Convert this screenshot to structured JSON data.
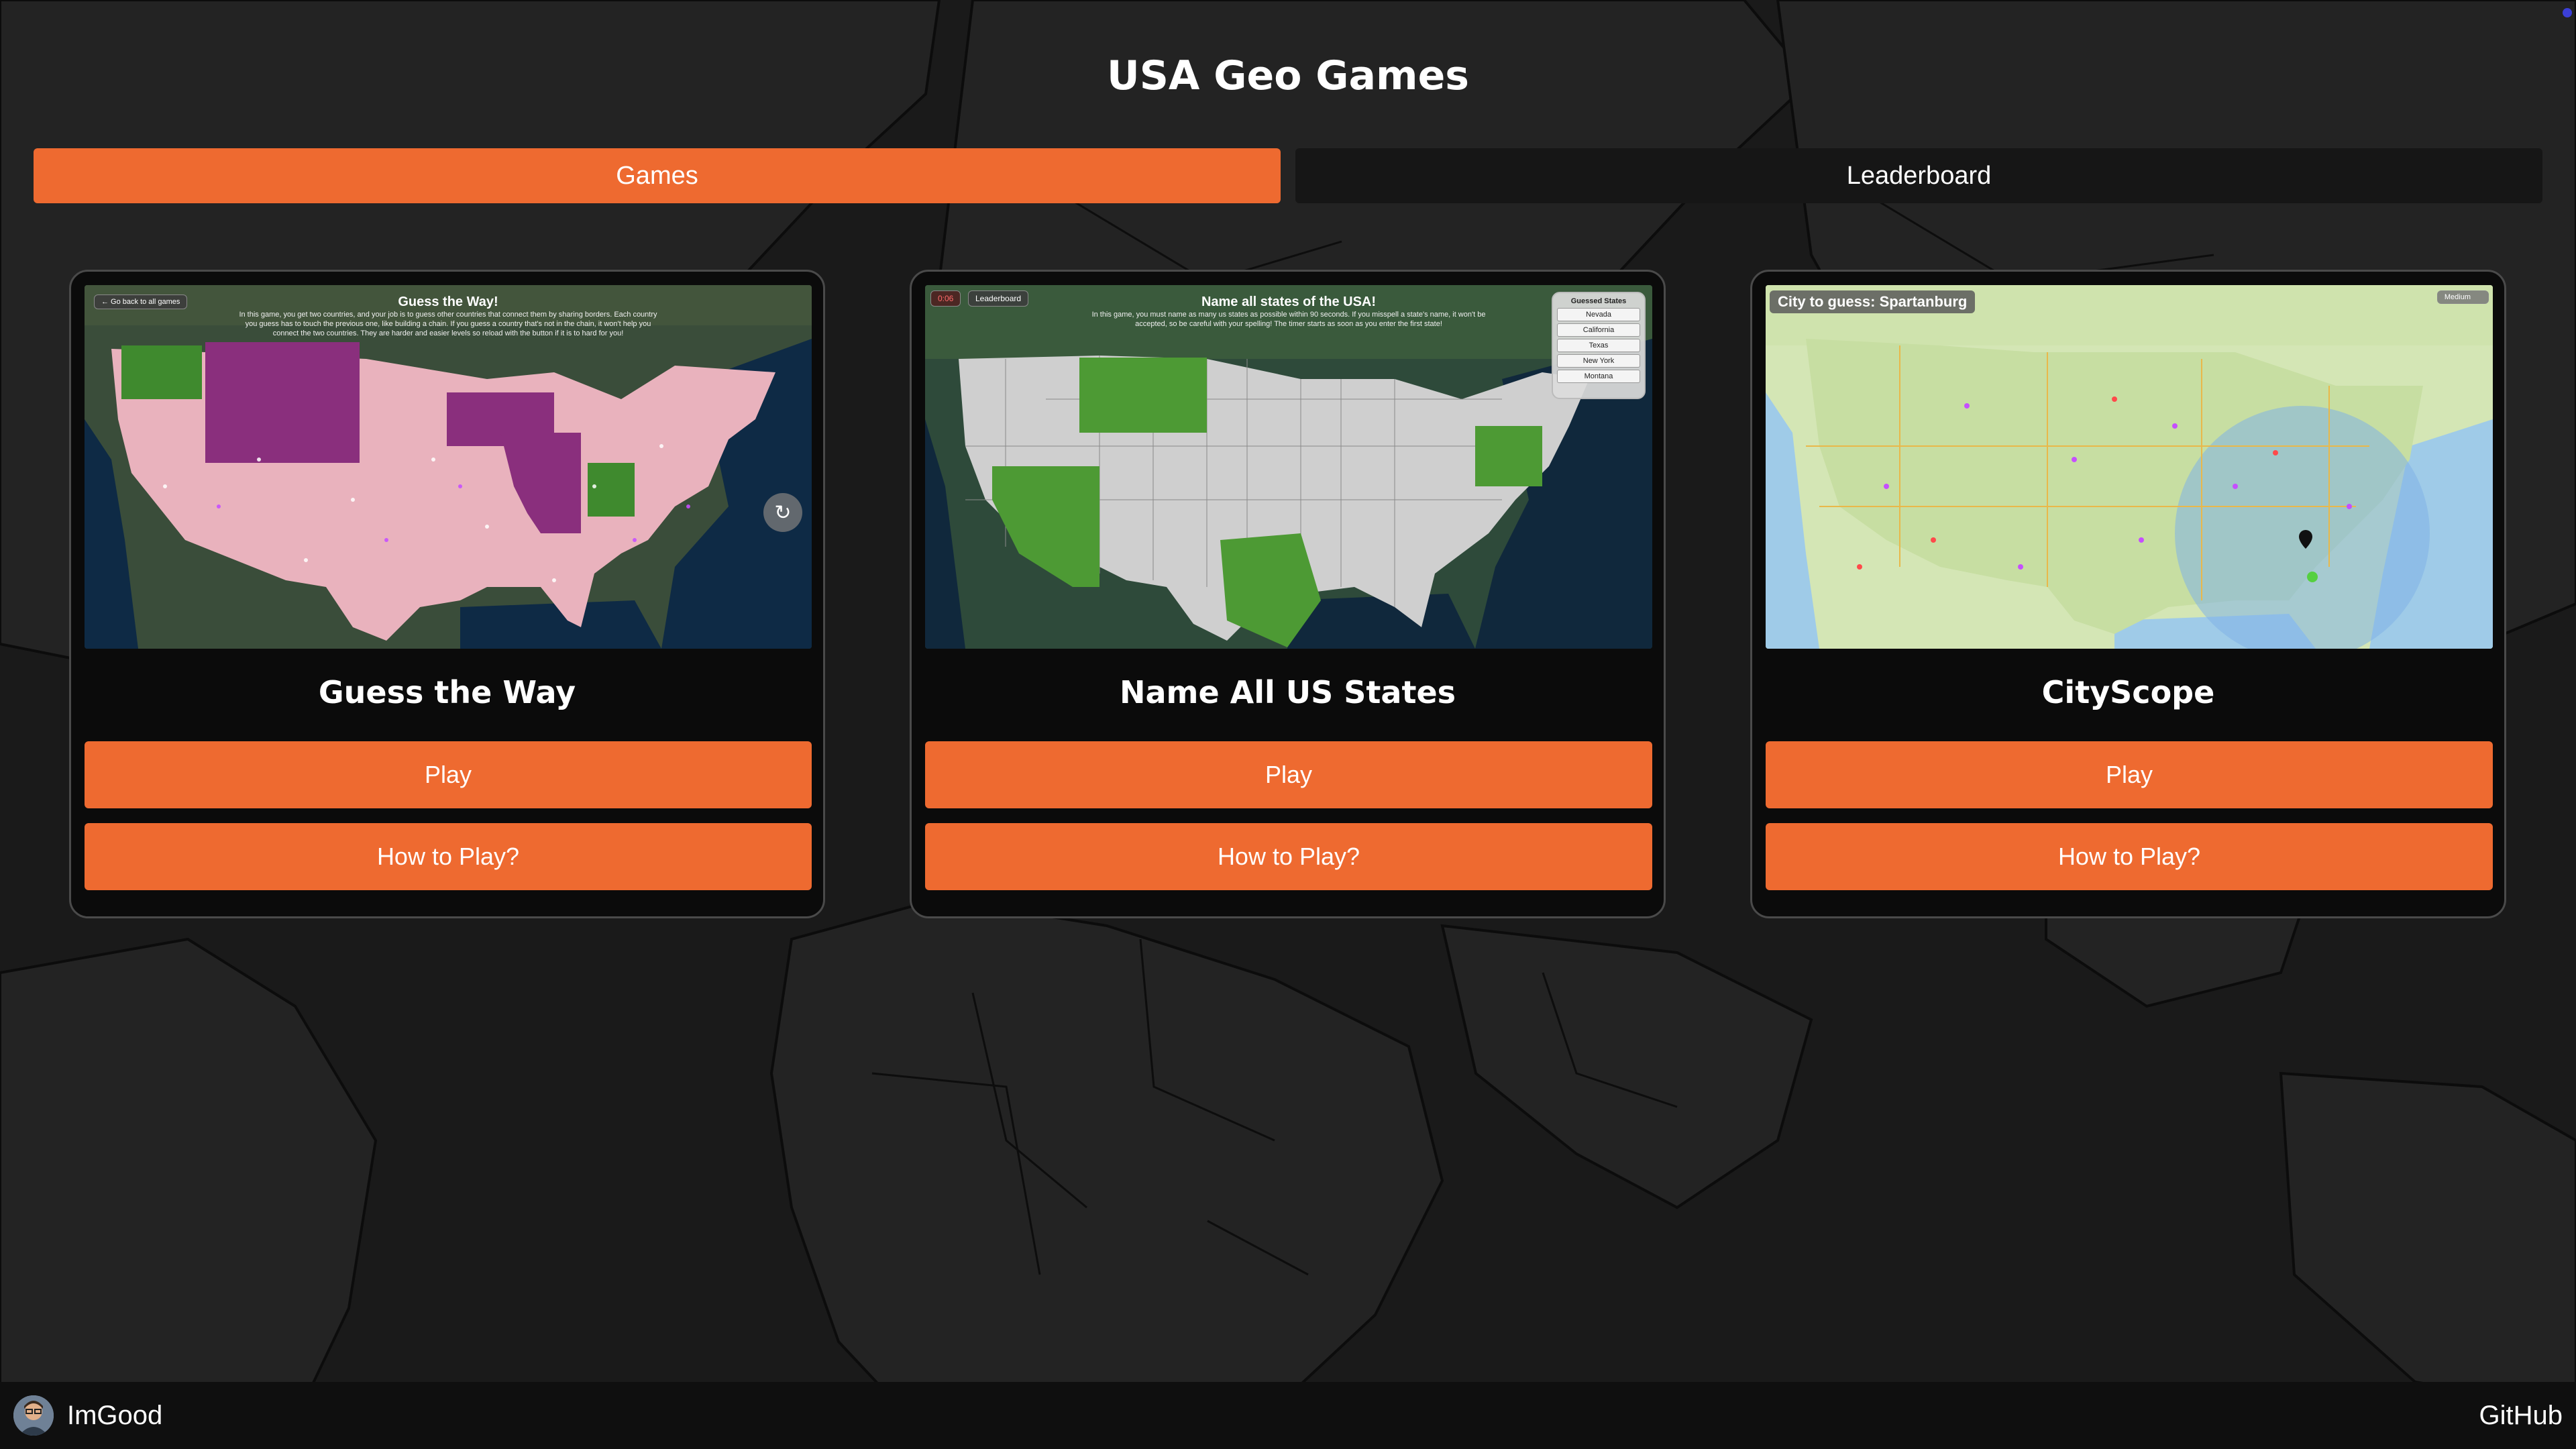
{
  "header": {
    "title": "USA Geo Games"
  },
  "tabs": [
    {
      "label": "Games",
      "active": true
    },
    {
      "label": "Leaderboard",
      "active": false
    }
  ],
  "games": [
    {
      "title": "Guess the Way",
      "play_label": "Play",
      "howto_label": "How to Play?",
      "preview": {
        "back_label": "← Go back to all games",
        "heading": "Guess the Way!",
        "description": "In this game, you get two countries, and your job is to guess other countries that connect them by sharing borders. Each country you guess has to touch the previous one, like building a chain. If you guess a country that's not in the chain, it won't help you connect the two countries. They are harder and easier levels so reload with the button if it is to hard for you!",
        "refresh_icon": "refresh-icon"
      }
    },
    {
      "title": "Name All US States",
      "play_label": "Play",
      "howto_label": "How to Play?",
      "preview": {
        "timer": "0:06",
        "leaderboard_label": "Leaderboard",
        "heading": "Name all states of the USA!",
        "description": "In this game, you must name as many us states as possible within 90 seconds. If you misspell a state's name, it won't be accepted, so be careful with your spelling! The timer starts as soon as you enter the first state!",
        "guessed_header": "Guessed States",
        "guessed_states": [
          "Nevada",
          "California",
          "Texas",
          "New York",
          "Montana"
        ]
      }
    },
    {
      "title": "CityScope",
      "play_label": "Play",
      "howto_label": "How to Play?",
      "preview": {
        "city_prompt": "City to guess: Spartanburg",
        "difficulty": "Medium"
      }
    }
  ],
  "footer": {
    "username": "ImGood",
    "github_label": "GitHub"
  },
  "colors": {
    "accent": "#ee6a30",
    "background": "#1b1b1b",
    "card": "#0b0b0b",
    "card_border": "#4a4a4a"
  }
}
